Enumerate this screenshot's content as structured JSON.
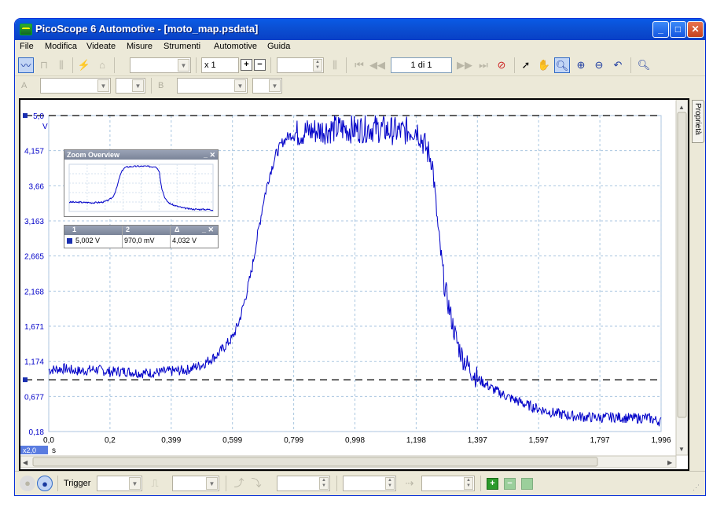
{
  "window": {
    "title": "PicoScope 6 Automotive - [moto_map.psdata]",
    "minimize": "_",
    "maximize": "□",
    "close": "✕"
  },
  "menu": [
    "File",
    "Modifica",
    "Videate",
    "Misure",
    "Strumenti",
    "Automotive",
    "Guida"
  ],
  "toolbar": {
    "zoom_factor": "x 1",
    "page_indicator": "1 di 1",
    "channel_a_label": "A",
    "channel_b_label": "B"
  },
  "scope": {
    "y_unit": "V",
    "x_unit": "s",
    "x_zoom_badge": "x2,0",
    "y_ticks": [
      "5,0",
      "4,157",
      "3,66",
      "3,163",
      "2,665",
      "2,168",
      "1,671",
      "1,174",
      "0,677",
      "0,18"
    ],
    "x_ticks": [
      "0,0",
      "0,2",
      "0,399",
      "0,599",
      "0,799",
      "0,998",
      "1,198",
      "1,397",
      "1,597",
      "1,797",
      "1,996"
    ],
    "trace_color": "#0000c8"
  },
  "zoom_overview": {
    "title": "Zoom Overview",
    "controls": "_ ✕"
  },
  "measurements": {
    "col1": "1",
    "col2": "2",
    "col3": "Δ",
    "controls": "_ ✕",
    "rule1_value": "5,002 V",
    "rule2_value": "970,0 mV",
    "delta_value": "4,032 V"
  },
  "side_tab": "Proprietà",
  "statusbar": {
    "trigger_label": "Trigger"
  },
  "chart_data": {
    "type": "line",
    "xlabel": "s",
    "ylabel": "V",
    "xlim": [
      0.0,
      1.996
    ],
    "ylim": [
      0.18,
      5.0
    ],
    "ruler_levels": [
      5.002,
      0.97
    ],
    "series": [
      {
        "x": [
          0.0,
          0.05,
          0.1,
          0.15,
          0.2,
          0.25,
          0.3,
          0.35,
          0.4,
          0.45,
          0.5,
          0.55,
          0.6,
          0.62,
          0.64,
          0.66,
          0.68,
          0.7,
          0.72,
          0.74,
          0.76,
          0.78,
          0.8,
          0.85,
          0.9,
          0.95,
          1.0,
          1.05,
          1.1,
          1.15,
          1.2,
          1.25,
          1.27,
          1.29,
          1.31,
          1.33,
          1.35,
          1.37,
          1.4,
          1.45,
          1.5,
          1.55,
          1.6,
          1.65,
          1.7,
          1.75,
          1.8,
          1.85,
          1.9,
          1.95,
          1.996
        ],
        "values": [
          1.12,
          1.14,
          1.1,
          1.13,
          1.09,
          1.1,
          1.07,
          1.08,
          1.1,
          1.12,
          1.2,
          1.35,
          1.62,
          1.85,
          2.2,
          2.6,
          3.15,
          3.7,
          4.1,
          4.4,
          4.58,
          4.68,
          4.72,
          4.76,
          4.78,
          4.8,
          4.79,
          4.81,
          4.78,
          4.75,
          4.8,
          4.3,
          3.2,
          2.4,
          1.95,
          1.55,
          1.3,
          1.15,
          0.98,
          0.82,
          0.7,
          0.6,
          0.52,
          0.46,
          0.42,
          0.4,
          0.39,
          0.4,
          0.38,
          0.39,
          0.33
        ]
      }
    ]
  }
}
